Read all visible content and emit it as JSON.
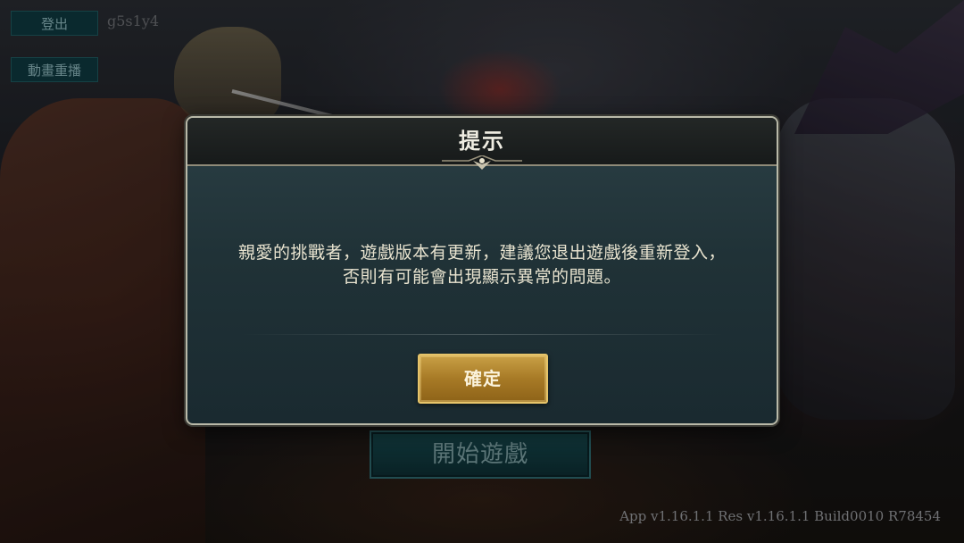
{
  "top_bar": {
    "logout_label": "登出",
    "user_id": "g5s1y4",
    "replay_label": "動畫重播"
  },
  "main": {
    "start_label": "開始遊戲"
  },
  "footer": {
    "version": "App v1.16.1.1 Res v1.16.1.1 Build0010 R78454"
  },
  "dialog": {
    "title": "提示",
    "message_lines": [
      "親愛的挑戰者，遊戲版本有更新，建議您退出遊戲後重新登入，",
      "否則有可能會出現顯示異常的問題。"
    ],
    "confirm_label": "確定"
  },
  "colors": {
    "accent_gold": "#c9a046",
    "teal_button": "#0e3a40",
    "dialog_bg": "#203237"
  }
}
